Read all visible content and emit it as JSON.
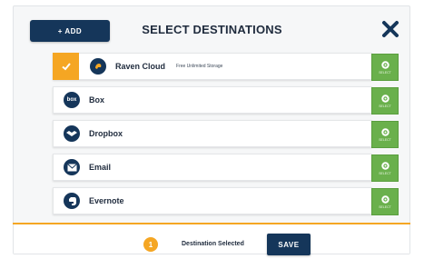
{
  "header": {
    "add_label": "+ ADD",
    "title": "SELECT DESTINATIONS",
    "close_icon": "close-icon"
  },
  "destinations": [
    {
      "name": "Raven Cloud",
      "tag": "Free Unlimited Storage",
      "selected": true,
      "icon": "raven-cloud-icon",
      "select_label": "SELECT"
    },
    {
      "name": "Box",
      "tag": "",
      "selected": false,
      "icon": "box-icon",
      "select_label": "SELECT"
    },
    {
      "name": "Dropbox",
      "tag": "",
      "selected": false,
      "icon": "dropbox-icon",
      "select_label": "SELECT"
    },
    {
      "name": "Email",
      "tag": "",
      "selected": false,
      "icon": "email-icon",
      "select_label": "SELECT"
    },
    {
      "name": "Evernote",
      "tag": "",
      "selected": false,
      "icon": "evernote-icon",
      "select_label": "SELECT"
    }
  ],
  "footer": {
    "count": "1",
    "count_label": "Destination Selected",
    "save_label": "SAVE"
  },
  "colors": {
    "navy": "#15365a",
    "orange": "#f5a623",
    "green": "#6ab04c"
  }
}
